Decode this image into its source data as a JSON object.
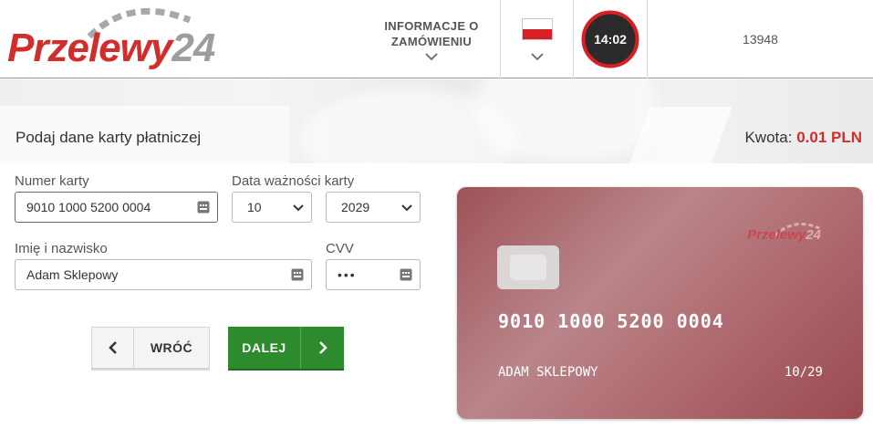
{
  "header": {
    "logo_main": "Przelewy",
    "logo_num": "24",
    "info_label": "INFORMACJE O ZAMÓWIENIU",
    "timer": "14:02",
    "merchant_id": "13948"
  },
  "banner": {
    "title": "Podaj dane karty płatniczej",
    "amount_label": "Kwota:",
    "amount_value": "0.01 PLN"
  },
  "form": {
    "card_number_label": "Numer karty",
    "card_number_value": "9010 1000 5200 0004",
    "expiry_label": "Data ważności karty",
    "expiry_month": "10",
    "expiry_year": "2029",
    "name_label": "Imię i nazwisko",
    "name_value": "Adam Sklepowy",
    "cvv_label": "CVV",
    "cvv_value": "•••"
  },
  "buttons": {
    "back_label": "WRÓĆ",
    "next_label": "DALEJ"
  },
  "card": {
    "logo_main": "Przelewy",
    "logo_num": "24",
    "number": "9010 1000 5200 0004",
    "holder": "ADAM SKLEPOWY",
    "expiry": "10/29"
  },
  "colors": {
    "brand_red": "#d12d2d",
    "next_green": "#2d8a2d",
    "card_base": "#a85a60"
  },
  "icons": {
    "info_chevron": "chevron-down-icon",
    "lang_chevron": "chevron-down-icon",
    "keyboard": "keyboard-icon",
    "select_arrow": "caret-down-icon",
    "back": "chevron-left-icon",
    "next": "chevron-right-icon"
  }
}
